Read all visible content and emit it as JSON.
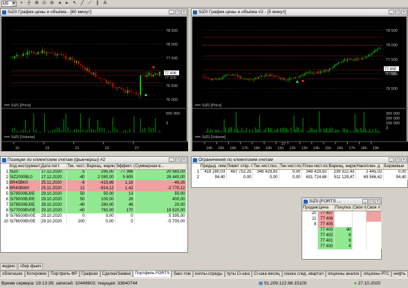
{
  "toolbar": {
    "timeframe": "M5"
  },
  "chart1": {
    "title": "SiZ0 График цены и объёма - [60 минут]",
    "price_legend": "SiZ0 [Price]",
    "volume_legend": "SiZ0 [Volume]",
    "y_ticks": [
      "78 500",
      "78 000",
      "77 500",
      "77 000",
      "76 500",
      "76 000"
    ],
    "last_price": "77 408",
    "last_price2": "77 320",
    "vol_ticks": [
      "500 000",
      "3"
    ],
    "x_ticks": [
      "15",
      "19",
      "21",
      "23",
      "27"
    ]
  },
  "chart2": {
    "title": "SiZ0 График цены и объёма #2 - [5 минут]",
    "price_legend": "SiZ0 [Price]",
    "volume_legend": "SiZ0 [Volume]",
    "y_ticks": [
      "78 500",
      "78 000",
      "77 500",
      "77 000",
      "76 500"
    ],
    "last_price": "77 408",
    "last_price2": "77 320",
    "vol_ticks": [
      "300 000",
      "200 000",
      "100 000",
      "3"
    ],
    "x_ticks_top": [
      "27"
    ],
    "x_ticks": [
      "14h",
      "15h",
      "16h",
      "17h",
      "18h",
      "19h",
      "11h",
      "12h",
      "13h",
      "14h",
      "15h",
      "16h",
      "17h",
      "18h",
      "19h"
    ]
  },
  "positions": {
    "title": "Позиции по клиентским счетам (фьючерсы) #2",
    "columns": [
      "Код инструмента",
      "Дата погт.",
      "Тек. чист.",
      "Вариац. маржа",
      "Эффект. цена",
      "Суммарная в..."
    ],
    "rows": [
      {
        "code": "SiZ0",
        "date": "17.12.2020",
        "qty": "5",
        "varmargin": "295,00",
        "price": "77 366",
        "total": "20 983,00",
        "color": "green"
      },
      {
        "code": "SiZ2000BL0",
        "date": "17.12.2020",
        "qty": "-40",
        "varmargin": "2 080,00",
        "price": "5 605",
        "total": "28 440,00",
        "color": "green"
      },
      {
        "code": "BR43BK0",
        "date": "25.11.2020",
        "qty": "-6",
        "varmargin": "-415,86",
        "price": "1,18",
        "total": "-46,26",
        "color": "red"
      },
      {
        "code": "BR40BW0",
        "date": "25.11.2020",
        "qty": "12",
        "varmargin": "-924,12",
        "price": "1,42",
        "total": "-2 775,12",
        "color": "red"
      },
      {
        "code": "Si79500BJ0E",
        "date": "29.10.2020",
        "qty": "50",
        "varmargin": "50,00",
        "price": "13",
        "total": "50,00",
        "color": "green"
      },
      {
        "code": "Si79000BJ0E",
        "date": "29.10.2020",
        "qty": "50",
        "varmargin": "100,00",
        "price": "26",
        "total": "400,00",
        "color": "green"
      },
      {
        "code": "Si78500BJ0E",
        "date": "29.10.2020",
        "qty": "-40",
        "varmargin": "280,00",
        "price": "46",
        "total": "20,00",
        "color": "green"
      },
      {
        "code": "Si77000BV0E",
        "date": "29.10.2020",
        "qty": "-40",
        "varmargin": "760,00",
        "price": "170",
        "total": "19 520,00",
        "color": "green"
      },
      {
        "code": "Si76500BV0E",
        "date": "29.10.2020",
        "qty": "0",
        "varmargin": "0,00",
        "price": "0",
        "total": "5 395,00",
        "color": "none"
      },
      {
        "code": "Si76000BV0E",
        "date": "29.10.2020",
        "qty": "100",
        "varmargin": "0,00",
        "price": "0",
        "total": "-5 700,00",
        "color": "none"
      }
    ]
  },
  "limits": {
    "title": "Ограничения по клиентским счетам",
    "columns": [
      "Предыд. лими",
      "Лимит откр. п",
      "Тек.чист.поз.",
      "Тек.чист.поз.(",
      "План.чист.поз.",
      "Вариац. маржа",
      "Накоплен. д",
      "Биржевые"
    ],
    "rows": [
      [
        "418 280,03",
        "487 752,25",
        "348 429,82",
        "0,00",
        "348 429,82",
        "139 322,43",
        "2 445,02",
        "0,00"
      ],
      [
        "94,40",
        "0,00",
        "0,00",
        "0,00",
        "631 724,68",
        "511 129,47",
        "69 566,62",
        "94,40"
      ]
    ]
  },
  "orderbook": {
    "title": "SiZ0 [FORTS ...",
    "columns": [
      "Продаж",
      "Цена",
      "Покупка",
      "Своя п",
      "Своя л"
    ],
    "rows": [
      {
        "sell": "20",
        "price": "77 407",
        "buy": "",
        "side": "sell"
      },
      {
        "sell": "11",
        "price": "77 406",
        "buy": "",
        "side": "sell"
      },
      {
        "sell": "8",
        "price": "77 405",
        "buy": "",
        "side": "sell"
      },
      {
        "sell": "",
        "price": "77 403",
        "buy": "40",
        "side": "buy"
      },
      {
        "sell": "",
        "price": "77 402",
        "buy": "8",
        "side": "buy"
      },
      {
        "sell": "",
        "price": "77 401",
        "buy": "9",
        "side": "buy"
      },
      {
        "sell": "",
        "price": "77 400",
        "buy": "4",
        "side": "buy"
      }
    ]
  },
  "small_tabs": [
    "яндекс",
    "сбер фьюч"
  ],
  "tabs": [
    "облигашки",
    "Котировки",
    "Портфель ФР",
    "Графики",
    "Сделки/Заявки",
    "Портфель FORTS",
    "бакс-том",
    "коллы-спреды",
    "путы Сi-шка",
    "Сi-шка месяц",
    "сишка след. квартал",
    "опционы анализ",
    "опционы РТС",
    "нефть"
  ],
  "active_tab": "Портфель FORTS",
  "status": {
    "server_time": "Время сервера: 19:13:39; записей: 10449603; текущая: 33640744",
    "ip": "91.209.122.66:15100",
    "date": "27.10.2020"
  },
  "colors": {
    "green": "#90e890",
    "red": "#f0a0a0",
    "buy_bg": "#90e890",
    "sell_bg": "#f0a0a0",
    "candle_up": "#00e000",
    "candle_down": "#e00000"
  }
}
